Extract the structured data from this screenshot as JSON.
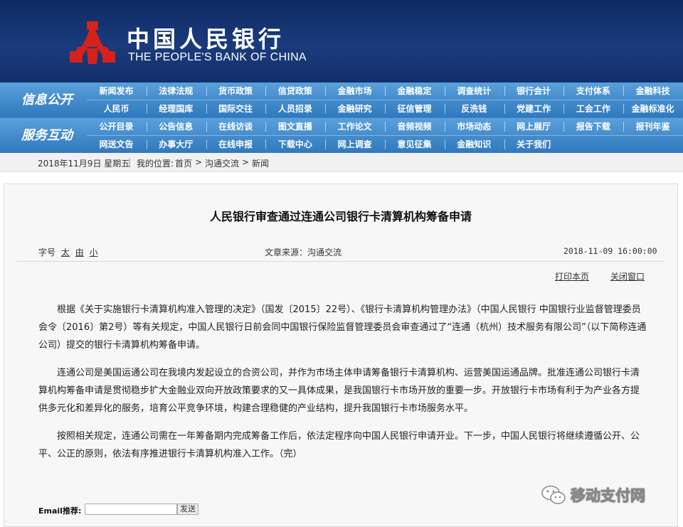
{
  "header": {
    "title_cn": "中国人民银行",
    "title_en": "THE PEOPLE'S BANK OF CHINA",
    "brand_red": "#d6221a"
  },
  "nav": {
    "sections": [
      {
        "label": "信息公开",
        "items": [
          "新闻发布",
          "法律法规",
          "货币政策",
          "信贷政策",
          "金融市场",
          "金融稳定",
          "调查统计",
          "银行会计",
          "支付体系",
          "金融科技",
          "人民币",
          "经理国库",
          "国际交往",
          "人员招录",
          "金融研究",
          "征信管理",
          "反洗钱",
          "党建工作",
          "工会工作",
          "金融标准化"
        ]
      },
      {
        "label": "服务互动",
        "items": [
          "公开目录",
          "公告信息",
          "在线访谈",
          "图文直播",
          "工作论文",
          "音频视频",
          "市场动态",
          "网上展厅",
          "报告下载",
          "报刊年鉴",
          "网送文告",
          "办事大厅",
          "在线申报",
          "下载中心",
          "网上调查",
          "意见征集",
          "金融知识",
          "关于我们"
        ]
      }
    ]
  },
  "breadcrumb": {
    "date": "2018年11月9日 星期五",
    "sep": "|",
    "location_label": "我的位置:",
    "home": "首页",
    "level1": "沟通交流",
    "level2": "新闻",
    "arrow": ">"
  },
  "article": {
    "title": "人民银行审查通过连通公司银行卡清算机构筹备申请",
    "font_size_label": "字号",
    "font_sizes": [
      "太",
      "由",
      "小"
    ],
    "source": "文章来源：沟通交流",
    "datetime": "2018-11-09 16:00:00",
    "print_label": "打印本页",
    "close_label": "关闭窗口",
    "paragraphs": [
      "根据《关于实施银行卡清算机构准入管理的决定》（国发〔2015〕22号）、《银行卡清算机构管理办法》（中国人民银行 中国银行业监督管理委员会令〔2016〕第2号）等有关规定，中国人民银行日前会同中国银行保险监督管理委员会审查通过了“连通（杭州）技术服务有限公司”（以下简称连通公司）提交的银行卡清算机构筹备申请。",
      "连通公司是美国运通公司在我境内发起设立的合资公司，并作为市场主体申请筹备银行卡清算机构、运营美国运通品牌。批准连通公司银行卡清算机构筹备申请是贯彻稳步扩大金融业双向开放政策要求的又一具体成果，是我国银行卡市场开放的重要一步。开放银行卡市场有利于为产业各方提供多元化和差异化的服务，培育公平竞争环境，构建合理稳健的产业结构，提升我国银行卡市场服务水平。",
      "按照相关规定，连通公司需在一年筹备期内完成筹备工作后，依法定程序向中国人民银行申请开业。下一步，中国人民银行将继续遵循公开、公平、公正的原则，依法有序推进银行卡清算机构准入工作。（完）"
    ]
  },
  "footer": {
    "email_label": "Email推荐:",
    "email_value": "",
    "send_label": "发送"
  },
  "watermark": {
    "text": "移动支付网",
    "icon": "wechat-icon"
  }
}
